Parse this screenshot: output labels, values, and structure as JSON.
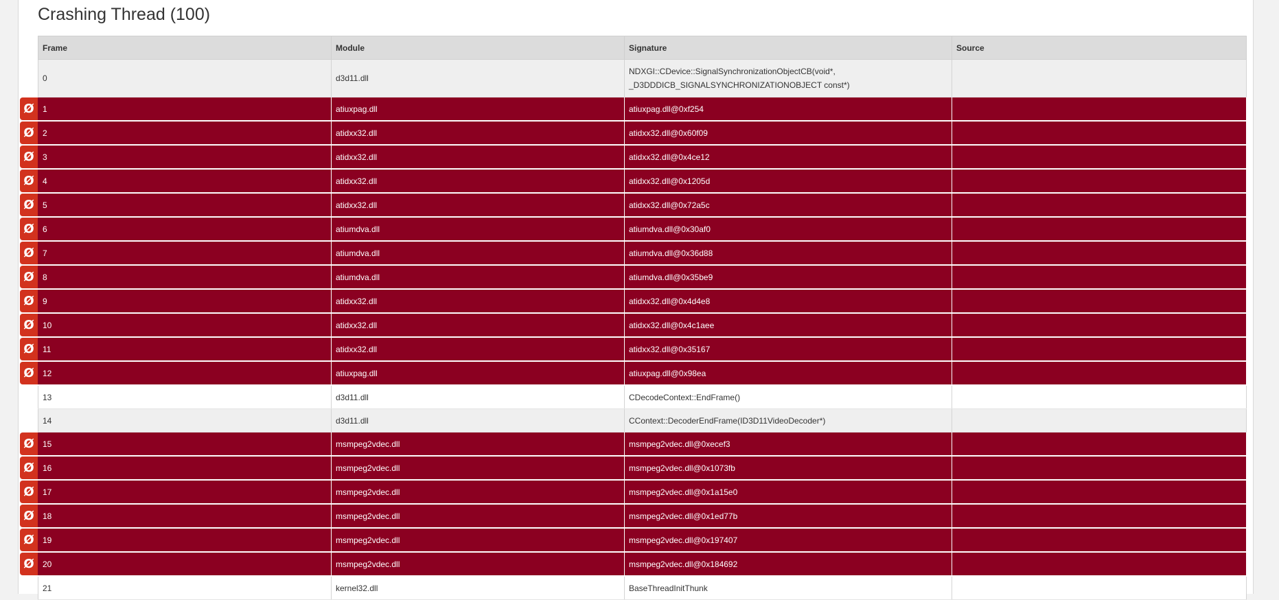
{
  "thread": {
    "title": "Crashing Thread (100)"
  },
  "table": {
    "headers": {
      "frame": "Frame",
      "module": "Module",
      "signature": "Signature",
      "source": "Source"
    },
    "rows": [
      {
        "frame": "0",
        "module": "d3d11.dll",
        "signature": "NDXGI::CDevice::SignalSynchronizationObjectCB(void*, _D3DDDICB_SIGNALSYNCHRONIZATIONOBJECT const*)",
        "source": "",
        "missing": false
      },
      {
        "frame": "1",
        "module": "atiuxpag.dll",
        "signature": "atiuxpag.dll@0xf254",
        "source": "",
        "missing": true
      },
      {
        "frame": "2",
        "module": "atidxx32.dll",
        "signature": "atidxx32.dll@0x60f09",
        "source": "",
        "missing": true
      },
      {
        "frame": "3",
        "module": "atidxx32.dll",
        "signature": "atidxx32.dll@0x4ce12",
        "source": "",
        "missing": true
      },
      {
        "frame": "4",
        "module": "atidxx32.dll",
        "signature": "atidxx32.dll@0x1205d",
        "source": "",
        "missing": true
      },
      {
        "frame": "5",
        "module": "atidxx32.dll",
        "signature": "atidxx32.dll@0x72a5c",
        "source": "",
        "missing": true
      },
      {
        "frame": "6",
        "module": "atiumdva.dll",
        "signature": "atiumdva.dll@0x30af0",
        "source": "",
        "missing": true
      },
      {
        "frame": "7",
        "module": "atiumdva.dll",
        "signature": "atiumdva.dll@0x36d88",
        "source": "",
        "missing": true
      },
      {
        "frame": "8",
        "module": "atiumdva.dll",
        "signature": "atiumdva.dll@0x35be9",
        "source": "",
        "missing": true
      },
      {
        "frame": "9",
        "module": "atidxx32.dll",
        "signature": "atidxx32.dll@0x4d4e8",
        "source": "",
        "missing": true
      },
      {
        "frame": "10",
        "module": "atidxx32.dll",
        "signature": "atidxx32.dll@0x4c1aee",
        "source": "",
        "missing": true
      },
      {
        "frame": "11",
        "module": "atidxx32.dll",
        "signature": "atidxx32.dll@0x35167",
        "source": "",
        "missing": true
      },
      {
        "frame": "12",
        "module": "atiuxpag.dll",
        "signature": "atiuxpag.dll@0x98ea",
        "source": "",
        "missing": true
      },
      {
        "frame": "13",
        "module": "d3d11.dll",
        "signature": "CDecodeContext::EndFrame()",
        "source": "",
        "missing": false
      },
      {
        "frame": "14",
        "module": "d3d11.dll",
        "signature": "CContext::DecoderEndFrame(ID3D11VideoDecoder*)",
        "source": "",
        "missing": false
      },
      {
        "frame": "15",
        "module": "msmpeg2vdec.dll",
        "signature": "msmpeg2vdec.dll@0xecef3",
        "source": "",
        "missing": true
      },
      {
        "frame": "16",
        "module": "msmpeg2vdec.dll",
        "signature": "msmpeg2vdec.dll@0x1073fb",
        "source": "",
        "missing": true
      },
      {
        "frame": "17",
        "module": "msmpeg2vdec.dll",
        "signature": "msmpeg2vdec.dll@0x1a15e0",
        "source": "",
        "missing": true
      },
      {
        "frame": "18",
        "module": "msmpeg2vdec.dll",
        "signature": "msmpeg2vdec.dll@0x1ed77b",
        "source": "",
        "missing": true
      },
      {
        "frame": "19",
        "module": "msmpeg2vdec.dll",
        "signature": "msmpeg2vdec.dll@0x197407",
        "source": "",
        "missing": true
      },
      {
        "frame": "20",
        "module": "msmpeg2vdec.dll",
        "signature": "msmpeg2vdec.dll@0x184692",
        "source": "",
        "missing": true
      },
      {
        "frame": "21",
        "module": "kernel32.dll",
        "signature": "BaseThreadInitThunk",
        "source": "",
        "missing": false
      }
    ]
  },
  "missing_symbol_icon": {
    "icon": "no-symbols-icon",
    "glyph": "Ø"
  },
  "colors": {
    "missing_row": "#8b0021",
    "missing_badge": "#d2321e",
    "header": "#dcdcdc"
  }
}
